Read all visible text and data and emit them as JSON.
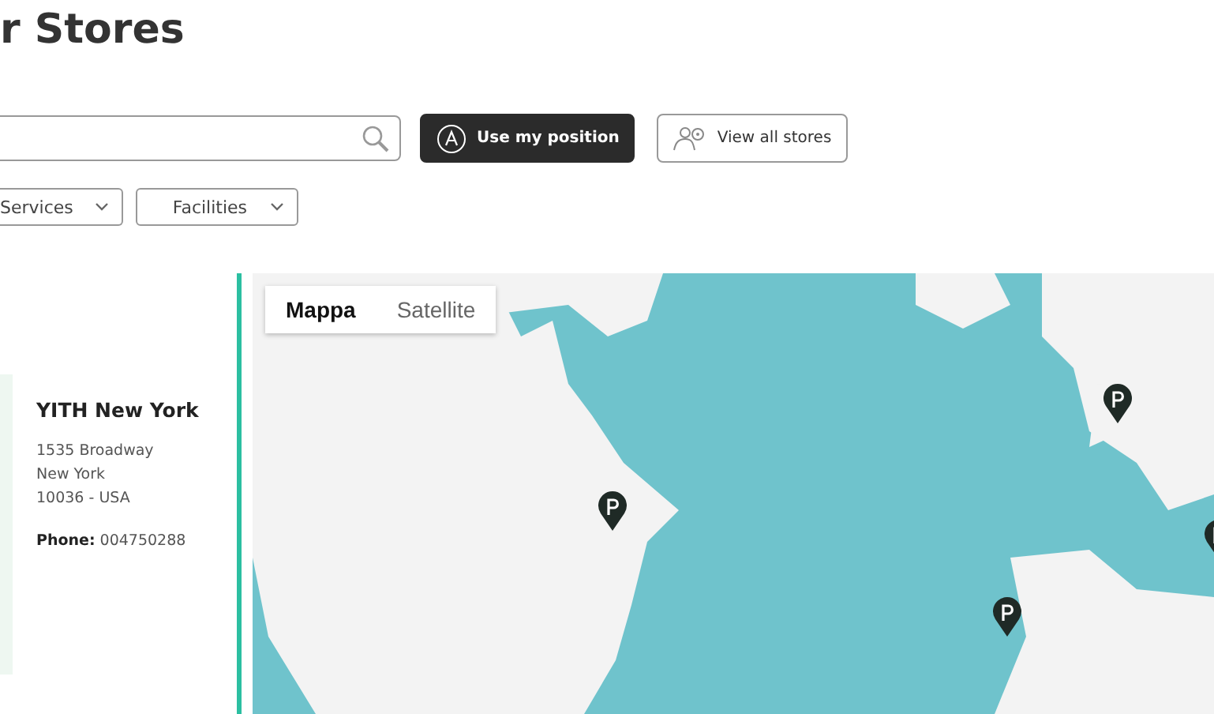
{
  "page_title": "r Stores",
  "actions": [
    {
      "kind": "position",
      "label": "Use my position"
    },
    {
      "kind": "all",
      "label": "View all stores"
    }
  ],
  "filters": [
    {
      "label": "Services"
    },
    {
      "label": "Facilities"
    }
  ],
  "store": {
    "name": "YITH New York",
    "address_lines": [
      "1535 Broadway",
      "New York",
      "10036 - USA"
    ],
    "phone_label": "Phone:",
    "phone": "004750288"
  },
  "map": {
    "tabs": [
      {
        "label": "Mappa",
        "selected": true
      },
      {
        "label": "Satellite",
        "selected": false
      }
    ]
  }
}
